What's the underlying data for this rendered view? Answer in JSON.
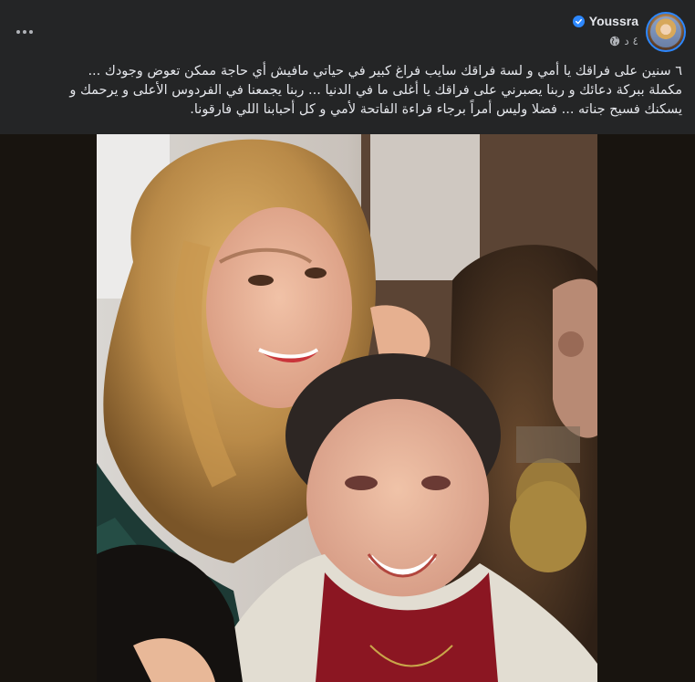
{
  "post": {
    "author_name": "Youssra",
    "verified_icon": "verified-badge-icon",
    "timestamp": "٤ د",
    "audience_icon": "globe-icon",
    "more_icon": "more-options-icon",
    "caption_lines": [
      "٦ سنين على فراقك يا أمي و لسة فراقك سايب فراغ كبير في حياتي مافيش أي حاجة ممكن تعوض وجودك ...",
      "مكملة ببركة دعائك و ربنا يصبرني على فراقك يا أغلى ما في الدنيا ... ربنا يجمعنا في الفردوس الأعلى و يرحمك و",
      "يسكنك فسيح جناته ... فضلا وليس أمراً برجاء قراءة الفاتحة لأمي و كل أحبابنا اللي فارقونا."
    ]
  },
  "colors": {
    "background": "#242526",
    "text": "#e4e6eb",
    "secondary_text": "#b0b3b8",
    "accent": "#2d88ff",
    "media_background": "#18140f"
  }
}
